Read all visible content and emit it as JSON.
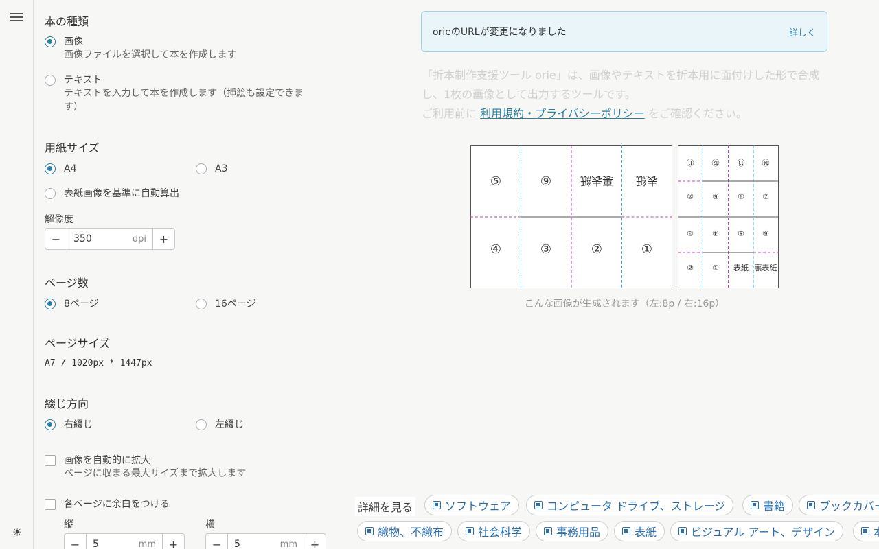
{
  "sidebar": {
    "menu_icon": "hamburger-icon",
    "theme_icon": "sun-icon"
  },
  "book_type": {
    "title": "本の種類",
    "options": [
      {
        "label": "画像",
        "desc": "画像ファイルを選択して本を作成します",
        "selected": true
      },
      {
        "label": "テキスト",
        "desc": "テキストを入力して本を作成します（挿絵も設定できま",
        "desc2": "す）",
        "selected": false
      }
    ]
  },
  "paper": {
    "title": "用紙サイズ",
    "a4": "A4",
    "a3": "A3",
    "auto": "表紙画像を基準に自動算出",
    "resolution_label": "解像度",
    "resolution_value": "350",
    "resolution_unit": "dpi"
  },
  "pages": {
    "title": "ページ数",
    "opt8": "8ページ",
    "opt16": "16ページ"
  },
  "page_size": {
    "title": "ページサイズ",
    "value": "A7 / 1020px * 1447px"
  },
  "binding": {
    "title": "綴じ方向",
    "right": "右綴じ",
    "left": "左綴じ"
  },
  "auto_scale": {
    "label": "画像を自動的に拡大",
    "desc": "ページに収まる最大サイズまで拡大します"
  },
  "margin": {
    "label": "各ページに余白をつける",
    "vertical_label": "縦",
    "vertical_value": "5",
    "horizontal_label": "横",
    "horizontal_value": "5",
    "unit": "mm"
  },
  "notice": {
    "message": "orieのURLが変更になりました",
    "more": "詳しく"
  },
  "intro": {
    "line1": "「折本制作支援ツール orie」は、画像やテキストを折本用に面付けした形で合成",
    "line2": "し、1枚の画像として出力するツールです。",
    "line3_pre": "ご利用前に",
    "link": "利用規約・プライバシーポリシー",
    "line3_post": "をご確認ください。"
  },
  "diagram": {
    "p8_top": [
      "⑤",
      "⑨",
      "裏表紙",
      "表紙"
    ],
    "p8_bottom": [
      "④",
      "③",
      "②",
      "①"
    ],
    "p16_rows": [
      [
        "⑪",
        "⑫",
        "⑬",
        "⑭"
      ],
      [
        "⑩",
        "⑨",
        "⑧",
        "⑦"
      ],
      [
        "③",
        "④",
        "⑤",
        "⑥"
      ],
      [
        "②",
        "①",
        "表紙",
        "裏表紙"
      ]
    ],
    "caption": "こんな画像が生成されます（左:8p / 右:16p）"
  },
  "chips": {
    "see_more": "詳細を見る",
    "row1": [
      "ソフトウェア",
      "コンピュータ ドライブ、ストレージ",
      "書籍",
      "ブックカバー"
    ],
    "row2": [
      "織物、不織布",
      "社会科学",
      "事務用品",
      "表紙",
      "ビジュアル アート、デザイン",
      "本"
    ]
  }
}
